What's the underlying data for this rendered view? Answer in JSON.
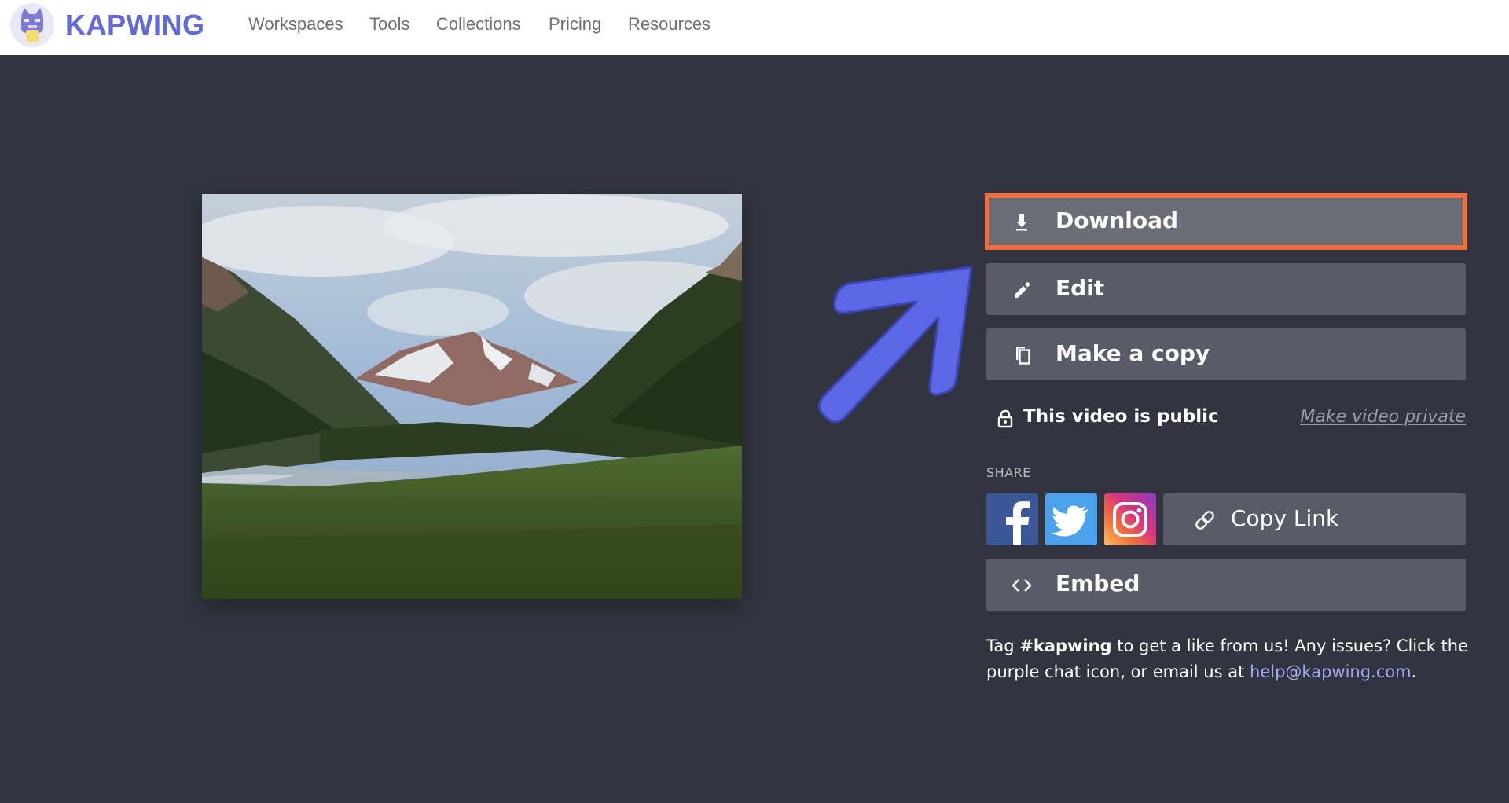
{
  "header": {
    "brand": "KAPWING",
    "nav": [
      "Workspaces",
      "Tools",
      "Collections",
      "Pricing",
      "Resources"
    ]
  },
  "actions": {
    "download": {
      "label": "Download",
      "icon": "download-icon"
    },
    "edit": {
      "label": "Edit",
      "icon": "pencil-icon"
    },
    "copy": {
      "label": "Make a copy",
      "icon": "copy-icon"
    }
  },
  "visibility": {
    "status": "This video is public",
    "toggle_link": "Make video private",
    "icon": "lock-icon"
  },
  "share": {
    "label": "SHARE",
    "networks": [
      "facebook",
      "twitter",
      "instagram"
    ],
    "copy_link": "Copy Link",
    "embed": "Embed"
  },
  "help": {
    "prefix": "Tag ",
    "tag": "#kapwing",
    "middle": " to get a like from us! Any issues? Click the purple chat icon, or email us at ",
    "email": "help@kapwing.com",
    "suffix": "."
  },
  "colors": {
    "brand": "#6269da",
    "background": "#32343f",
    "highlight": "#ef6e3d",
    "arrow": "#5b67e4"
  }
}
